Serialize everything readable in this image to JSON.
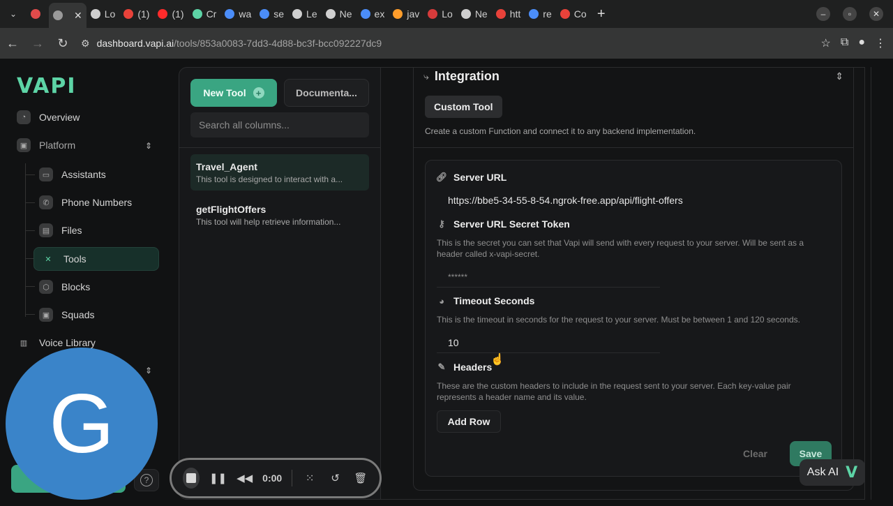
{
  "browser": {
    "tabs": [
      {
        "label": "",
        "color": "#e04b4b"
      },
      {
        "label": "",
        "color": "#9a9a9a",
        "active": true
      },
      {
        "label": "Lo",
        "color": "#cfcfcf"
      },
      {
        "label": "(1)",
        "color": "#e8423a"
      },
      {
        "label": "(1)",
        "color": "#ff2b2b"
      },
      {
        "label": "Cr",
        "color": "#5dd4a6"
      },
      {
        "label": "wa",
        "color": "#4b8df8"
      },
      {
        "label": "se",
        "color": "#4b8df8"
      },
      {
        "label": "Le",
        "color": "#cfcfcf"
      },
      {
        "label": "Ne",
        "color": "#cfcfcf"
      },
      {
        "label": "ex",
        "color": "#4b8df8"
      },
      {
        "label": "jav",
        "color": "#ff9d2b"
      },
      {
        "label": "Lo",
        "color": "#d63b3b"
      },
      {
        "label": "Ne",
        "color": "#cfcfcf"
      },
      {
        "label": "htt",
        "color": "#e8423a"
      },
      {
        "label": "re",
        "color": "#4b8df8"
      },
      {
        "label": "Co",
        "color": "#e8423a"
      }
    ],
    "url_host": "dashboard.vapi.ai",
    "url_path": "/tools/853a0083-7dd3-4d88-bc3f-bcc092227dc9"
  },
  "sidebar": {
    "logo": "VAPI",
    "overview": "Overview",
    "platform": "Platform",
    "items": [
      "Assistants",
      "Phone Numbers",
      "Files",
      "Tools",
      "Blocks",
      "Squads"
    ],
    "voice_library": "Voice Library"
  },
  "tools_panel": {
    "new_tool": "New Tool",
    "docs": "Documenta...",
    "search_placeholder": "Search all columns...",
    "tools": [
      {
        "title": "Travel_Agent",
        "desc": "This tool is designed to interact with a..."
      },
      {
        "title": "getFlightOffers",
        "desc": "This tool will help retrieve information..."
      }
    ]
  },
  "detail": {
    "integration_title": "Integration",
    "custom_tool": "Custom Tool",
    "integration_desc": "Create a custom Function and connect it to any backend implementation.",
    "server_url_label": "Server URL",
    "server_url_value": "https://bbe5-34-55-8-54.ngrok-free.app/api/flight-offers",
    "secret_label": "Server URL Secret Token",
    "secret_help": "This is the secret you can set that Vapi will send with every request to your server. Will be sent as a header called x-vapi-secret.",
    "secret_value": "******",
    "timeout_label": "Timeout Seconds",
    "timeout_help": "This is the timeout in seconds for the request to your server. Must be between 1 and 120 seconds.",
    "timeout_value": "10",
    "headers_label": "Headers",
    "headers_help": "These are the custom headers to include in the request sent to your server. Each key-value pair represents a header name and its value.",
    "add_row": "Add Row",
    "clear": "Clear",
    "save": "Save"
  },
  "recorder": {
    "time": "0:00"
  },
  "overlay": {
    "avatar_letter": "G",
    "ask_ai": "Ask AI",
    "ask_ai_logo": "V"
  }
}
